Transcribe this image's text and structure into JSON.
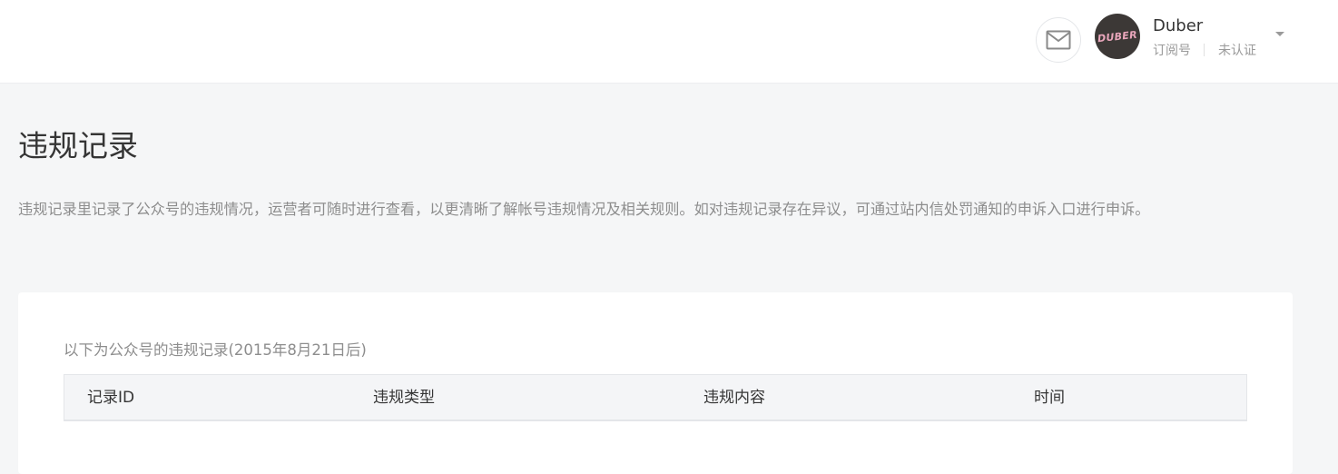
{
  "header": {
    "account_name": "Duber",
    "account_type": "订阅号",
    "verification_status": "未认证",
    "avatar_text": "DUBER",
    "icons": {
      "messages": "mail-icon",
      "dropdown": "caret-down-icon"
    }
  },
  "page": {
    "title": "违规记录",
    "description": "违规记录里记录了公众号的违规情况，运营者可随时进行查看，以更清晰了解帐号违规情况及相关规则。如对违规记录存在异议，可通过站内信处罚通知的申诉入口进行申诉。"
  },
  "records": {
    "caption": "以下为公众号的违规记录(2015年8月21日后)",
    "columns": [
      "记录ID",
      "违规类型",
      "违规内容",
      "时间"
    ],
    "rows": []
  },
  "colors": {
    "background": "#f5f6f7",
    "card": "#ffffff",
    "text_primary": "#353535",
    "text_secondary": "#8d8d8d",
    "table_header_bg": "#f4f5f7",
    "avatar_bg": "#3c3836",
    "avatar_text": "#e9a6bb"
  }
}
